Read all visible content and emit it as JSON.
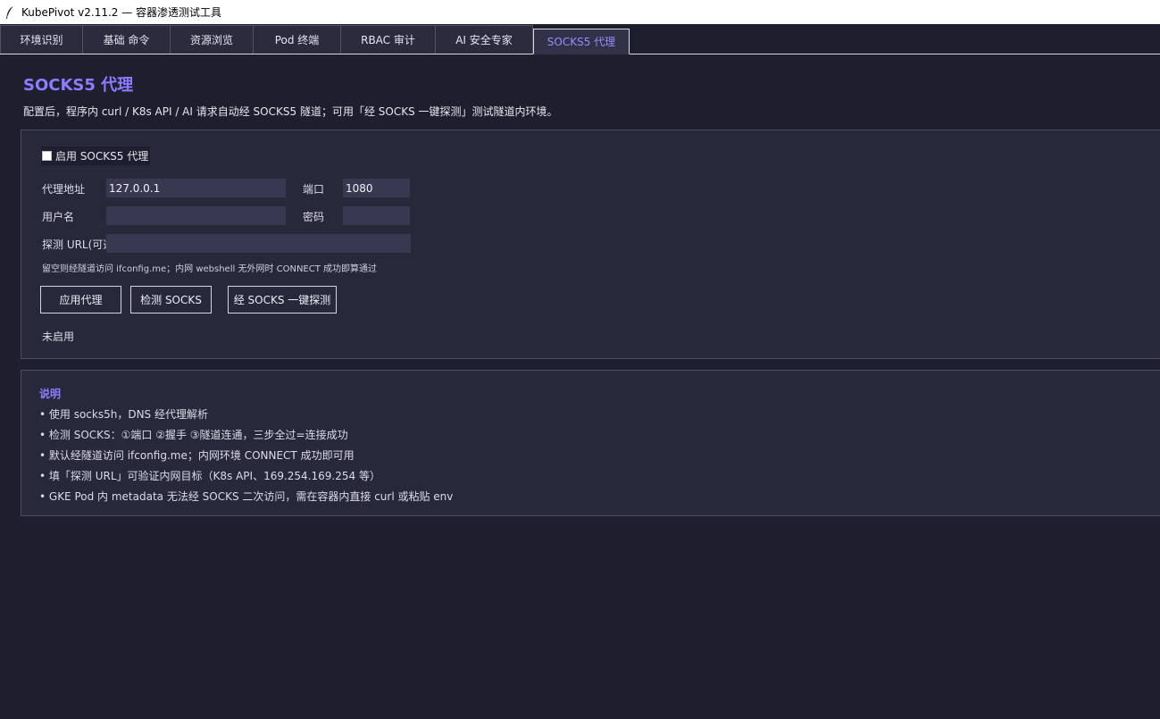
{
  "window": {
    "title": "KubePivot  v2.11.2 — 容器渗透测试工具",
    "icon": "feather-icon"
  },
  "tabs": [
    {
      "label": "环境识别",
      "active": false
    },
    {
      "label": "基础 命令",
      "active": false
    },
    {
      "label": "资源浏览",
      "active": false
    },
    {
      "label": "Pod 终端",
      "active": false
    },
    {
      "label": "RBAC 审计",
      "active": false
    },
    {
      "label": "AI 安全专家",
      "active": false
    },
    {
      "label": "SOCKS5 代理",
      "active": true
    }
  ],
  "page": {
    "title": "SOCKS5 代理",
    "subtitle": "配置后，程序内 curl / K8s API / AI 请求自动经 SOCKS5 隧道；可用「经 SOCKS 一键探测」测试隧道内环境。"
  },
  "settings": {
    "enable_label": "启用 SOCKS5 代理",
    "enabled": false,
    "address_label": "代理地址",
    "address_value": "127.0.0.1",
    "port_label": "端口",
    "port_value": "1080",
    "username_label": "用户名",
    "username_value": "",
    "password_label": "密码",
    "password_value": "",
    "probe_url_label": "探测 URL(可选",
    "probe_url_value": "",
    "hint": "留空则经隧道访问 ifconfig.me；内网 webshell 无外网时 CONNECT 成功即算通过",
    "apply_button": "应用代理",
    "check_button": "检测 SOCKS",
    "probe_button": "经 SOCKS 一键探测",
    "status": "未启用"
  },
  "notes": {
    "title": "说明",
    "lines": [
      "• 使用 socks5h，DNS 经代理解析",
      "• 检测 SOCKS：①端口 ②握手 ③隧道连通，三步全过=连接成功",
      "• 默认经隧道访问 ifconfig.me；内网环境 CONNECT 成功即可用",
      "• 填「探测 URL」可验证内网目标（K8s API、169.254.169.254 等）",
      "• GKE Pod 内 metadata 无法经 SOCKS 二次访问，需在容器内直接 curl 或粘贴 env"
    ]
  }
}
